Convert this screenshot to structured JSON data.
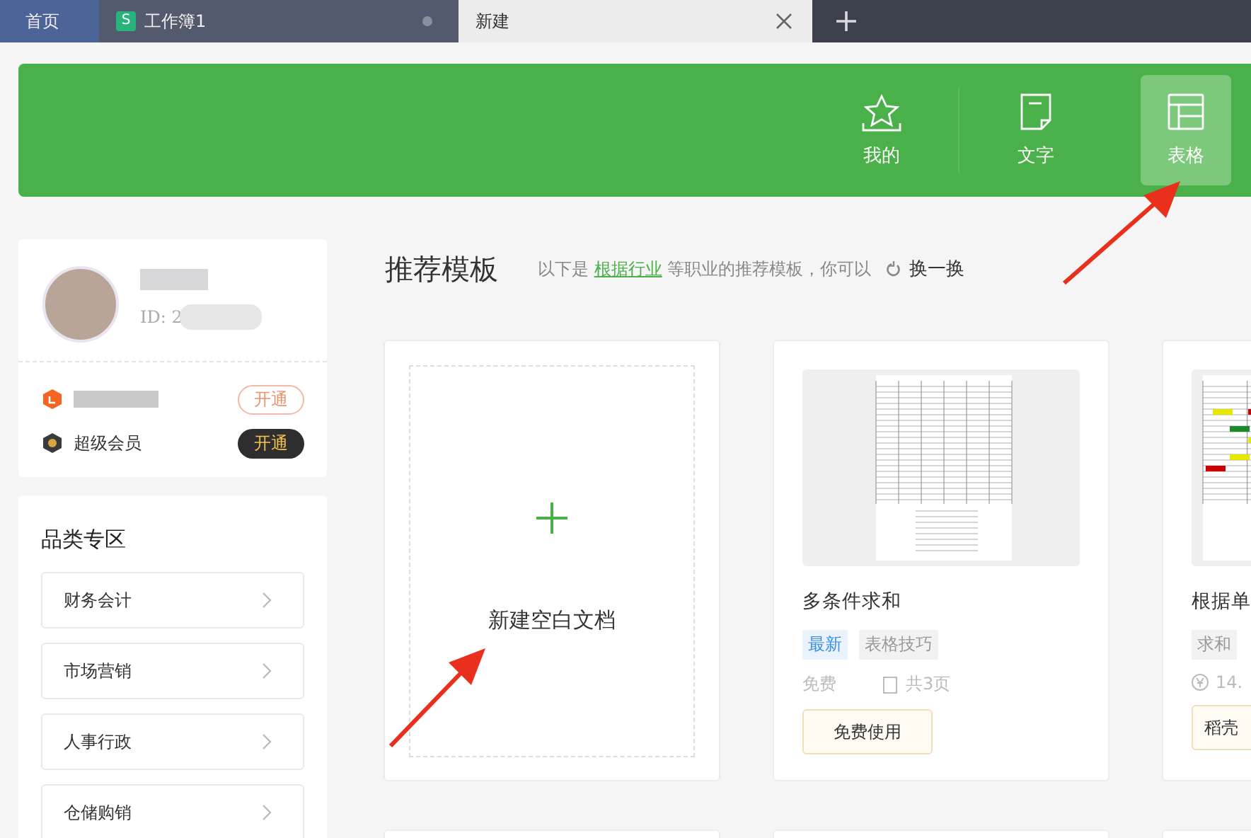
{
  "tabs": [
    {
      "label": "首页",
      "kind": "home",
      "selected": false
    },
    {
      "label": "工作簿1",
      "kind": "doc",
      "badge": "S",
      "selected": false
    },
    {
      "label": "新建",
      "kind": "doc",
      "selected": true
    }
  ],
  "banner": {
    "items": [
      {
        "label": "我的",
        "kind": "star",
        "selected": false
      },
      {
        "label": "文字",
        "kind": "note",
        "selected": false
      },
      {
        "label": "表格",
        "kind": "table",
        "selected": true
      }
    ]
  },
  "profile": {
    "id_label": "ID: 2",
    "memberships": [
      {
        "kind": "docer",
        "button": "开通"
      },
      {
        "kind": "super",
        "name": "超级会员",
        "button": "开通"
      }
    ]
  },
  "categories": {
    "title": "品类专区",
    "items": [
      "财务会计",
      "市场营销",
      "人事行政",
      "仓储购销"
    ]
  },
  "recommend": {
    "title": "推荐模板",
    "note_before": "以下是",
    "link": "根据行业",
    "note_after": "等职业的推荐模板，你可以",
    "refresh": "换一换"
  },
  "blank_card": {
    "label": "新建空白文档"
  },
  "templates": [
    {
      "kind": "free",
      "title": "多条件求和",
      "tags": [
        {
          "label": "最新",
          "kind": "new"
        },
        {
          "label": "表格技巧",
          "kind": "plain"
        }
      ],
      "price": "免费",
      "pages": "共3页",
      "button": "免费使用"
    },
    {
      "kind": "paid",
      "title": "根据单",
      "tags": [
        {
          "label": "求和",
          "kind": "plain"
        }
      ],
      "price": "14.",
      "button": "稻壳"
    }
  ]
}
